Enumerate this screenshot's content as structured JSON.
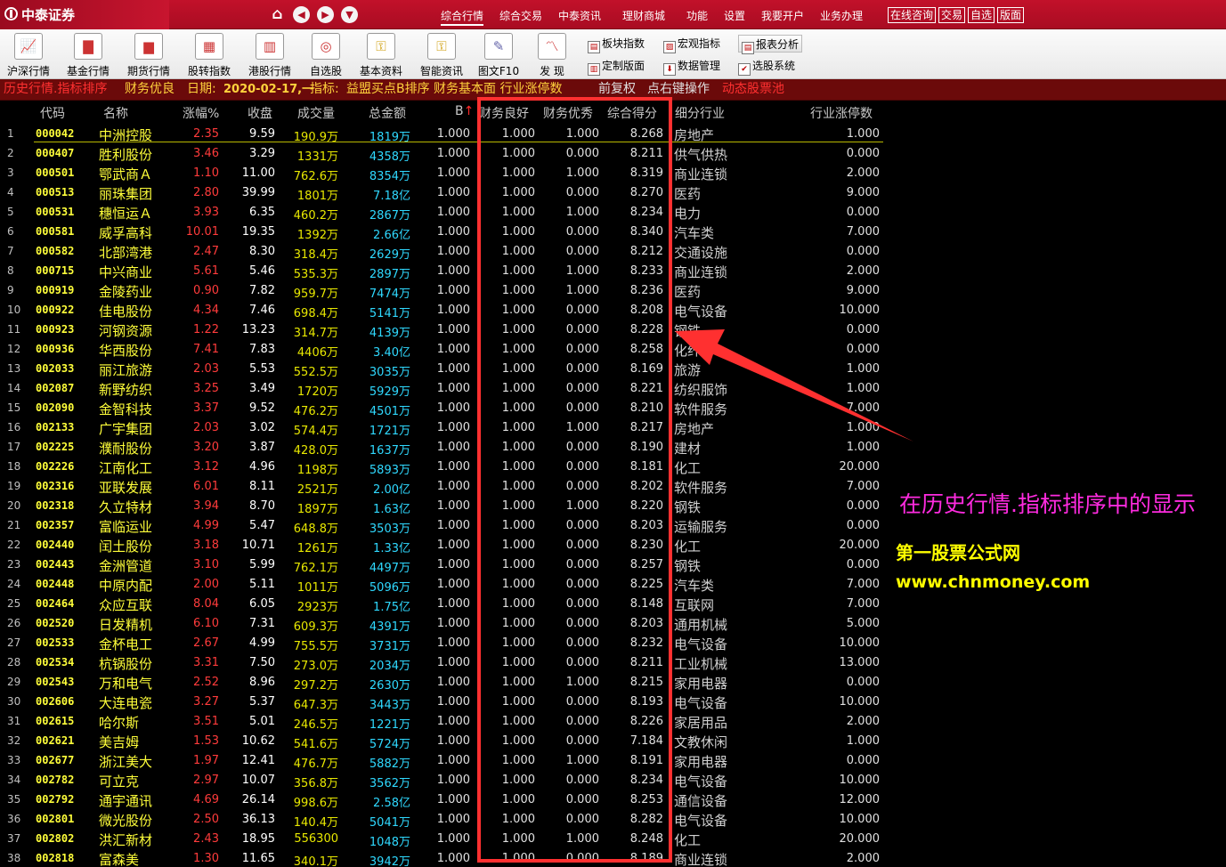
{
  "app": {
    "brand": "中泰证券"
  },
  "topnav": {
    "icons": [
      "home-icon",
      "back-icon",
      "forward-icon",
      "dropdown-icon"
    ],
    "menus": [
      "综合行情",
      "综合交易",
      "中泰资讯",
      "理财商城",
      "功能",
      "设置",
      "我要开户",
      "业务办理"
    ],
    "buttons": [
      "在线咨询",
      "交易",
      "自选",
      "版面"
    ]
  },
  "toolbar": {
    "tools": [
      "沪深行情",
      "基金行情",
      "期货行情",
      "股转指数",
      "港股行情",
      "自选股",
      "基本资料",
      "智能资讯",
      "图文F10",
      "发  现"
    ],
    "side_tools": [
      "板块指数",
      "宏观指标",
      "报表分析",
      "定制版面",
      "数据管理",
      "选股系统"
    ]
  },
  "infobar": {
    "mode": "历史行情.指标排序",
    "fin": "财务优良",
    "date_label": "日期:",
    "date_value": "2020-02-17,一",
    "ind_label": "指标:",
    "ind_value": "益盟买点B排序 财务基本面 行业涨停数",
    "fq": "前复权",
    "tip": "点右键操作",
    "pool": "动态股票池"
  },
  "columns": [
    "代码",
    "名称",
    "涨幅%",
    "收盘",
    "成交量",
    "总金额",
    "B",
    "财务良好",
    "财务优秀",
    "综合得分",
    "细分行业",
    "行业涨停数"
  ],
  "rows": [
    [
      "1",
      "000042",
      "中洲控股",
      "2.35",
      "9.59",
      "190.9万",
      "1819万",
      "1.000",
      "1.000",
      "1.000",
      "8.268",
      "房地产",
      "1.000"
    ],
    [
      "2",
      "000407",
      "胜利股份",
      "3.46",
      "3.29",
      "1331万",
      "4358万",
      "1.000",
      "1.000",
      "0.000",
      "8.211",
      "供气供热",
      "0.000"
    ],
    [
      "3",
      "000501",
      "鄂武商Ａ",
      "1.10",
      "11.00",
      "762.6万",
      "8354万",
      "1.000",
      "1.000",
      "1.000",
      "8.319",
      "商业连锁",
      "2.000"
    ],
    [
      "4",
      "000513",
      "丽珠集团",
      "2.80",
      "39.99",
      "1801万",
      "7.18亿",
      "1.000",
      "1.000",
      "0.000",
      "8.270",
      "医药",
      "9.000"
    ],
    [
      "5",
      "000531",
      "穗恒运Ａ",
      "3.93",
      "6.35",
      "460.2万",
      "2867万",
      "1.000",
      "1.000",
      "1.000",
      "8.234",
      "电力",
      "0.000"
    ],
    [
      "6",
      "000581",
      "威孚高科",
      "10.01",
      "19.35",
      "1392万",
      "2.66亿",
      "1.000",
      "1.000",
      "0.000",
      "8.340",
      "汽车类",
      "7.000"
    ],
    [
      "7",
      "000582",
      "北部湾港",
      "2.47",
      "8.30",
      "318.4万",
      "2629万",
      "1.000",
      "1.000",
      "0.000",
      "8.212",
      "交通设施",
      "0.000"
    ],
    [
      "8",
      "000715",
      "中兴商业",
      "5.61",
      "5.46",
      "535.3万",
      "2897万",
      "1.000",
      "1.000",
      "1.000",
      "8.233",
      "商业连锁",
      "2.000"
    ],
    [
      "9",
      "000919",
      "金陵药业",
      "0.90",
      "7.82",
      "959.7万",
      "7474万",
      "1.000",
      "1.000",
      "1.000",
      "8.236",
      "医药",
      "9.000"
    ],
    [
      "10",
      "000922",
      "佳电股份",
      "4.34",
      "7.46",
      "698.4万",
      "5141万",
      "1.000",
      "1.000",
      "0.000",
      "8.208",
      "电气设备",
      "10.000"
    ],
    [
      "11",
      "000923",
      "河钢资源",
      "1.22",
      "13.23",
      "314.7万",
      "4139万",
      "1.000",
      "1.000",
      "0.000",
      "8.228",
      "钢铁",
      "0.000"
    ],
    [
      "12",
      "000936",
      "华西股份",
      "7.41",
      "7.83",
      "4406万",
      "3.40亿",
      "1.000",
      "1.000",
      "0.000",
      "8.258",
      "化纤",
      "0.000"
    ],
    [
      "13",
      "002033",
      "丽江旅游",
      "2.03",
      "5.53",
      "552.5万",
      "3035万",
      "1.000",
      "1.000",
      "0.000",
      "8.169",
      "旅游",
      "1.000"
    ],
    [
      "14",
      "002087",
      "新野纺织",
      "3.25",
      "3.49",
      "1720万",
      "5929万",
      "1.000",
      "1.000",
      "0.000",
      "8.221",
      "纺织服饰",
      "1.000"
    ],
    [
      "15",
      "002090",
      "金智科技",
      "3.37",
      "9.52",
      "476.2万",
      "4501万",
      "1.000",
      "1.000",
      "0.000",
      "8.210",
      "软件服务",
      "7.000"
    ],
    [
      "16",
      "002133",
      "广宇集团",
      "2.03",
      "3.02",
      "574.4万",
      "1721万",
      "1.000",
      "1.000",
      "1.000",
      "8.217",
      "房地产",
      "1.000"
    ],
    [
      "17",
      "002225",
      "濮耐股份",
      "3.20",
      "3.87",
      "428.0万",
      "1637万",
      "1.000",
      "1.000",
      "0.000",
      "8.190",
      "建材",
      "1.000"
    ],
    [
      "18",
      "002226",
      "江南化工",
      "3.12",
      "4.96",
      "1198万",
      "5893万",
      "1.000",
      "1.000",
      "0.000",
      "8.181",
      "化工",
      "20.000"
    ],
    [
      "19",
      "002316",
      "亚联发展",
      "6.01",
      "8.11",
      "2521万",
      "2.00亿",
      "1.000",
      "1.000",
      "0.000",
      "8.202",
      "软件服务",
      "7.000"
    ],
    [
      "20",
      "002318",
      "久立特材",
      "3.94",
      "8.70",
      "1897万",
      "1.63亿",
      "1.000",
      "1.000",
      "1.000",
      "8.220",
      "钢铁",
      "0.000"
    ],
    [
      "21",
      "002357",
      "富临运业",
      "4.99",
      "5.47",
      "648.8万",
      "3503万",
      "1.000",
      "1.000",
      "0.000",
      "8.203",
      "运输服务",
      "0.000"
    ],
    [
      "22",
      "002440",
      "闰土股份",
      "3.18",
      "10.71",
      "1261万",
      "1.33亿",
      "1.000",
      "1.000",
      "0.000",
      "8.230",
      "化工",
      "20.000"
    ],
    [
      "23",
      "002443",
      "金洲管道",
      "3.10",
      "5.99",
      "762.1万",
      "4497万",
      "1.000",
      "1.000",
      "0.000",
      "8.257",
      "钢铁",
      "0.000"
    ],
    [
      "24",
      "002448",
      "中原内配",
      "2.00",
      "5.11",
      "1011万",
      "5096万",
      "1.000",
      "1.000",
      "0.000",
      "8.225",
      "汽车类",
      "7.000"
    ],
    [
      "25",
      "002464",
      "众应互联",
      "8.04",
      "6.05",
      "2923万",
      "1.75亿",
      "1.000",
      "1.000",
      "0.000",
      "8.148",
      "互联网",
      "7.000"
    ],
    [
      "26",
      "002520",
      "日发精机",
      "6.10",
      "7.31",
      "609.3万",
      "4391万",
      "1.000",
      "1.000",
      "0.000",
      "8.203",
      "通用机械",
      "5.000"
    ],
    [
      "27",
      "002533",
      "金杯电工",
      "2.67",
      "4.99",
      "755.5万",
      "3731万",
      "1.000",
      "1.000",
      "0.000",
      "8.232",
      "电气设备",
      "10.000"
    ],
    [
      "28",
      "002534",
      "杭锅股份",
      "3.31",
      "7.50",
      "273.0万",
      "2034万",
      "1.000",
      "1.000",
      "0.000",
      "8.211",
      "工业机械",
      "13.000"
    ],
    [
      "29",
      "002543",
      "万和电气",
      "2.52",
      "8.96",
      "297.2万",
      "2630万",
      "1.000",
      "1.000",
      "1.000",
      "8.215",
      "家用电器",
      "0.000"
    ],
    [
      "30",
      "002606",
      "大连电瓷",
      "3.27",
      "5.37",
      "647.3万",
      "3443万",
      "1.000",
      "1.000",
      "0.000",
      "8.193",
      "电气设备",
      "10.000"
    ],
    [
      "31",
      "002615",
      "哈尔斯",
      "3.51",
      "5.01",
      "246.5万",
      "1221万",
      "1.000",
      "1.000",
      "0.000",
      "8.226",
      "家居用品",
      "2.000"
    ],
    [
      "32",
      "002621",
      "美吉姆",
      "1.53",
      "10.62",
      "541.6万",
      "5724万",
      "1.000",
      "1.000",
      "0.000",
      "7.184",
      "文教休闲",
      "1.000"
    ],
    [
      "33",
      "002677",
      "浙江美大",
      "1.97",
      "12.41",
      "476.7万",
      "5882万",
      "1.000",
      "1.000",
      "1.000",
      "8.191",
      "家用电器",
      "0.000"
    ],
    [
      "34",
      "002782",
      "可立克",
      "2.97",
      "10.07",
      "356.8万",
      "3562万",
      "1.000",
      "1.000",
      "0.000",
      "8.234",
      "电气设备",
      "10.000"
    ],
    [
      "35",
      "002792",
      "通宇通讯",
      "4.69",
      "26.14",
      "998.6万",
      "2.58亿",
      "1.000",
      "1.000",
      "0.000",
      "8.253",
      "通信设备",
      "12.000"
    ],
    [
      "36",
      "002801",
      "微光股份",
      "2.50",
      "36.13",
      "140.4万",
      "5041万",
      "1.000",
      "1.000",
      "0.000",
      "8.282",
      "电气设备",
      "10.000"
    ],
    [
      "37",
      "002802",
      "洪汇新材",
      "2.43",
      "18.95",
      "556300",
      "1048万",
      "1.000",
      "1.000",
      "1.000",
      "8.248",
      "化工",
      "20.000"
    ],
    [
      "38",
      "002818",
      "富森美",
      "1.30",
      "11.65",
      "340.1万",
      "3942万",
      "1.000",
      "1.000",
      "0.000",
      "8.189",
      "商业连锁",
      "2.000"
    ]
  ],
  "annotation": {
    "caption": "在历史行情.指标排序中的显示",
    "site_name": "第一股票公式网",
    "site_url": "www.chnmoney.com",
    "highlight_color": "#ff3030"
  }
}
